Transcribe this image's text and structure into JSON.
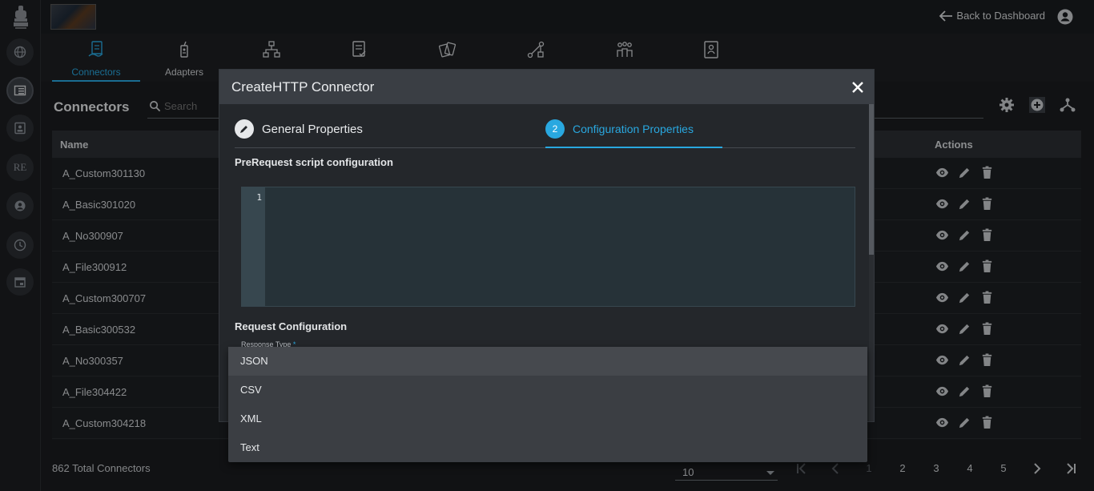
{
  "topbar": {
    "back_label": "Back to Dashboard"
  },
  "tabs": [
    {
      "label": "Connectors",
      "icon": "connector-icon"
    },
    {
      "label": "Adapters",
      "icon": "adapter-icon"
    },
    {
      "label": "",
      "icon": "dataset-icon"
    },
    {
      "label": "",
      "icon": "event-icon"
    },
    {
      "label": "",
      "icon": "automation-icon"
    },
    {
      "label": "",
      "icon": "sop-icon"
    },
    {
      "label": "",
      "icon": "groups-icon"
    },
    {
      "label": "",
      "icon": "distribution-icon"
    }
  ],
  "page": {
    "title": "Connectors",
    "search_placeholder": "Search"
  },
  "table": {
    "columns": [
      "Name",
      "Actions"
    ],
    "rows": [
      "A_Custom301130",
      "A_Basic301020",
      "A_No300907",
      "A_File300912",
      "A_Custom300707",
      "A_Basic300532",
      "A_No300357",
      "A_File304422",
      "A_Custom304218"
    ]
  },
  "footer": {
    "total": "862 Total Connectors",
    "page_size": "10",
    "pages": [
      "1",
      "2",
      "3",
      "4",
      "5"
    ]
  },
  "modal": {
    "title": "CreateHTTP Connector",
    "step1": "General Properties",
    "step2_number": "2",
    "step2": "Configuration Properties",
    "prerequest_label": "PreRequest script configuration",
    "line_number": "1",
    "request_label": "Request Configuration",
    "response_type_label": "Response Type",
    "required_mark": "*"
  },
  "dropdown": {
    "options": [
      "JSON",
      "CSV",
      "XML",
      "Text"
    ],
    "selected": "JSON"
  },
  "colors": {
    "accent": "#29a8e0",
    "background": "#1b1d20",
    "modal": "#24272b"
  }
}
